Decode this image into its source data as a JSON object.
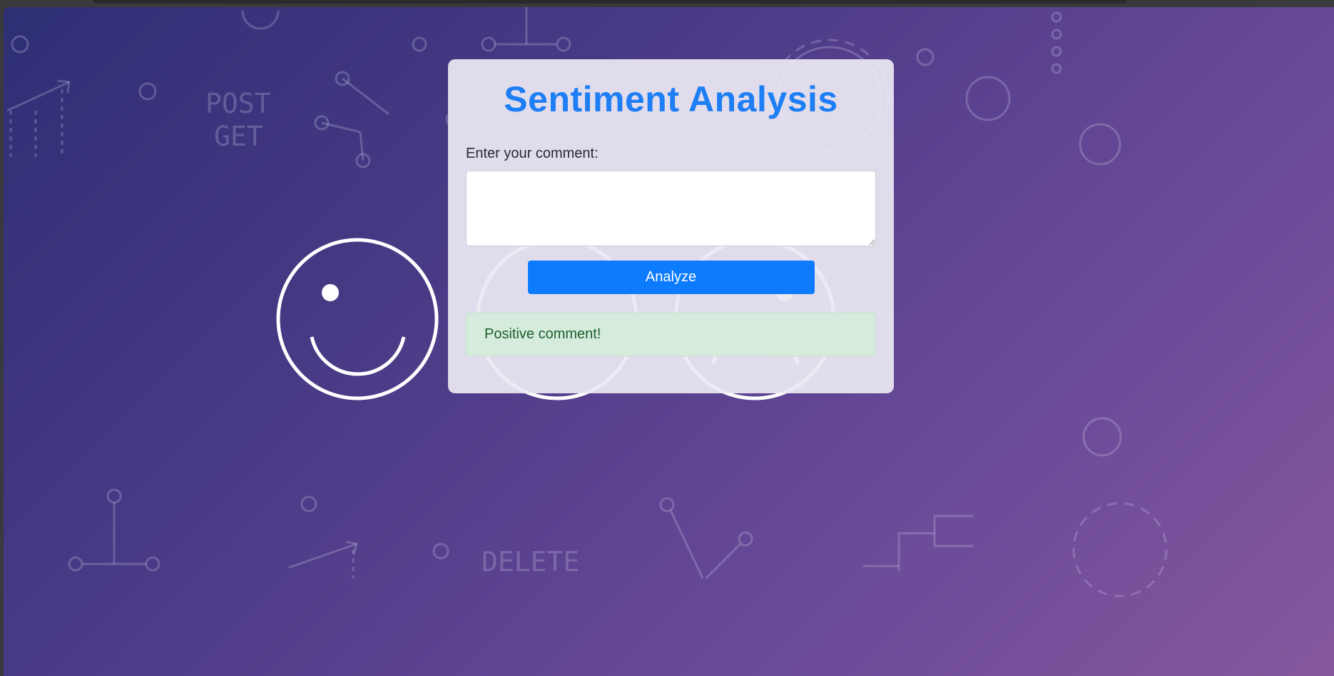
{
  "app": {
    "title": "Sentiment Analysis"
  },
  "form": {
    "comment_label": "Enter your comment:",
    "comment_value": "",
    "comment_placeholder": "",
    "analyze_label": "Analyze"
  },
  "result": {
    "message": "Positive comment!"
  },
  "background": {
    "labels": [
      "POST",
      "GET",
      "DELETE"
    ],
    "faces": [
      "happy-face",
      "neutral-face",
      "sad-face"
    ]
  },
  "colors": {
    "title": "#1e7ef5",
    "button": "#0d7bfe",
    "result_bg": "#d5ecdc",
    "result_text": "#1e5d2e"
  }
}
